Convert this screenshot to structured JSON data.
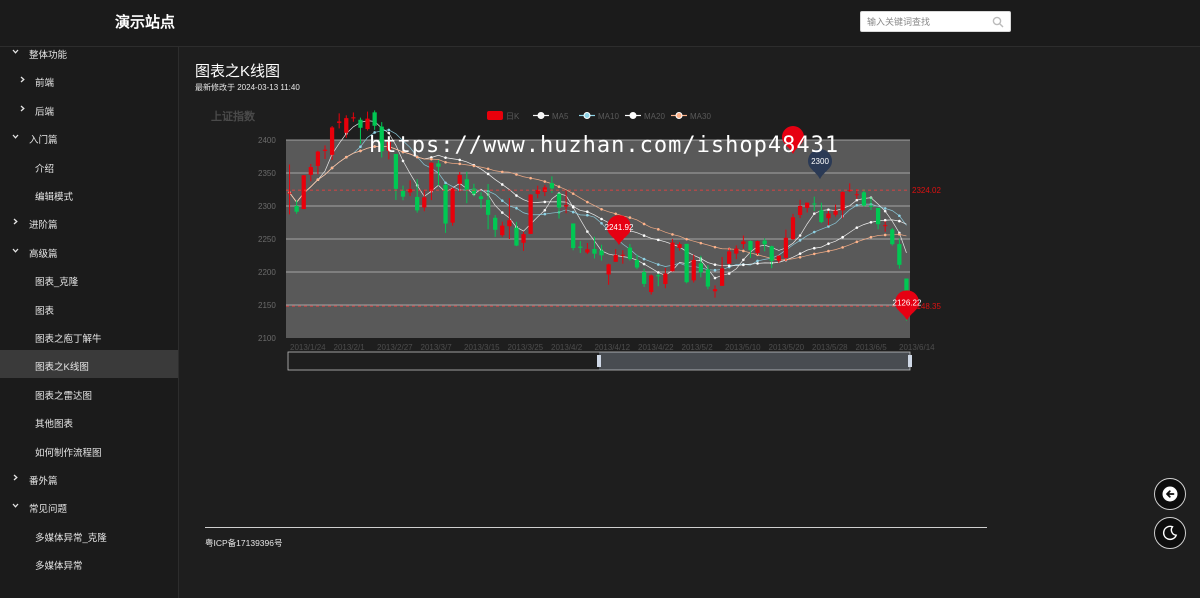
{
  "header": {
    "site_title": "演示站点",
    "search_placeholder": "输入关键词查找"
  },
  "sidebar": {
    "items": [
      {
        "label": "整体功能",
        "level": 0,
        "expanded": true
      },
      {
        "label": "前端",
        "level": 1,
        "expanded": false
      },
      {
        "label": "后端",
        "level": 1,
        "expanded": false
      },
      {
        "label": "入门篇",
        "level": 0,
        "expanded": true
      },
      {
        "label": "介绍",
        "level": 1
      },
      {
        "label": "编辑模式",
        "level": 1
      },
      {
        "label": "进阶篇",
        "level": 0,
        "expanded": false
      },
      {
        "label": "高级篇",
        "level": 0,
        "expanded": true
      },
      {
        "label": "图表_克隆",
        "level": 1
      },
      {
        "label": "图表",
        "level": 1
      },
      {
        "label": "图表之庖丁解牛",
        "level": 1
      },
      {
        "label": "图表之K线图",
        "level": 1,
        "active": true
      },
      {
        "label": "图表之雷达图",
        "level": 1
      },
      {
        "label": "其他图表",
        "level": 1
      },
      {
        "label": "如何制作流程图",
        "level": 1
      },
      {
        "label": "番外篇",
        "level": 0,
        "expanded": false
      },
      {
        "label": "常见问题",
        "level": 0,
        "expanded": true
      },
      {
        "label": "多媒体异常_克隆",
        "level": 1
      },
      {
        "label": "多媒体异常",
        "level": 1
      }
    ]
  },
  "content": {
    "page_title": "图表之K线图",
    "modified": "最新修改于 2024-03-13 11:40"
  },
  "watermark": "https://www.huzhan.com/ishop48431",
  "footer": {
    "icp": "粤ICP备17139396号"
  },
  "colors": {
    "up": "#e8000b",
    "down": "#00c853",
    "background": "#1e1e1e",
    "plot_bg": "#595959"
  },
  "icons": {
    "search": "search-icon",
    "back": "back-arrow-icon",
    "theme": "moon-icon"
  },
  "chart_data": {
    "type": "candlestick",
    "title": "上证指数",
    "legend": [
      "日K",
      "MA5",
      "MA10",
      "MA20",
      "MA30"
    ],
    "ylim": [
      2100,
      2400
    ],
    "y_ticks": [
      2100,
      2150,
      2200,
      2250,
      2300,
      2350,
      2400
    ],
    "x_ticks": [
      "2013/1/24",
      "2013/2/1",
      "2013/2/27",
      "2013/3/7",
      "2013/3/15",
      "2013/3/25",
      "2013/4/2",
      "2013/4/12",
      "2013/4/22",
      "2013/5/2",
      "2013/5/10",
      "2013/5/20",
      "2013/5/28",
      "2013/6/5",
      "2013/6/14"
    ],
    "candles": [
      {
        "o": 2320.26,
        "c": 2320.26,
        "l": 2287.3,
        "h": 2362.94
      },
      {
        "o": 2300,
        "c": 2291.3,
        "l": 2288.26,
        "h": 2308.38
      },
      {
        "o": 2295.35,
        "c": 2346.5,
        "l": 2295.35,
        "h": 2346.92
      },
      {
        "o": 2347.22,
        "c": 2358.98,
        "l": 2337.35,
        "h": 2363.8
      },
      {
        "o": 2360.75,
        "c": 2382.48,
        "l": 2347.89,
        "h": 2383.76
      },
      {
        "o": 2383.43,
        "c": 2385.42,
        "l": 2371.23,
        "h": 2391.82
      },
      {
        "o": 2377.41,
        "c": 2419.02,
        "l": 2369.57,
        "h": 2421.15
      },
      {
        "o": 2425.92,
        "c": 2428.15,
        "l": 2417.58,
        "h": 2440.38
      },
      {
        "o": 2411,
        "c": 2433.13,
        "l": 2403.3,
        "h": 2437.42
      },
      {
        "o": 2432.68,
        "c": 2434.48,
        "l": 2427.7,
        "h": 2441.73
      },
      {
        "o": 2430.69,
        "c": 2418.53,
        "l": 2394.22,
        "h": 2433.89
      },
      {
        "o": 2416.62,
        "c": 2432.4,
        "l": 2414.4,
        "h": 2443.03
      },
      {
        "o": 2441.91,
        "c": 2421.56,
        "l": 2415.43,
        "h": 2444.8
      },
      {
        "o": 2420.26,
        "c": 2382.91,
        "l": 2373.53,
        "h": 2427.07
      },
      {
        "o": 2383.49,
        "c": 2397.18,
        "l": 2370.61,
        "h": 2397.94
      },
      {
        "o": 2378.82,
        "c": 2325.95,
        "l": 2309.17,
        "h": 2378.82
      },
      {
        "o": 2322.94,
        "c": 2314.16,
        "l": 2308.76,
        "h": 2330.88
      },
      {
        "o": 2320.62,
        "c": 2325.82,
        "l": 2315.01,
        "h": 2338.78
      },
      {
        "o": 2313.74,
        "c": 2293.34,
        "l": 2289.89,
        "h": 2340.71
      },
      {
        "o": 2297.77,
        "c": 2313.22,
        "l": 2292.03,
        "h": 2324.63
      },
      {
        "o": 2322.32,
        "c": 2365.59,
        "l": 2308.92,
        "h": 2366.16
      },
      {
        "o": 2364.54,
        "c": 2359.51,
        "l": 2330.86,
        "h": 2369.65
      },
      {
        "o": 2332.08,
        "c": 2273.4,
        "l": 2259.25,
        "h": 2333.54
      },
      {
        "o": 2274.81,
        "c": 2326.31,
        "l": 2270.1,
        "h": 2328.14
      },
      {
        "o": 2333.61,
        "c": 2347.18,
        "l": 2321.6,
        "h": 2351.44
      },
      {
        "o": 2340.44,
        "c": 2324.29,
        "l": 2304.27,
        "h": 2352.02
      },
      {
        "o": 2326.42,
        "c": 2318.61,
        "l": 2314.59,
        "h": 2333.67
      },
      {
        "o": 2314.68,
        "c": 2310.59,
        "l": 2296.58,
        "h": 2320.96
      },
      {
        "o": 2309.16,
        "c": 2286.6,
        "l": 2264.83,
        "h": 2333.29
      },
      {
        "o": 2282.17,
        "c": 2263.97,
        "l": 2253.25,
        "h": 2286.33
      },
      {
        "o": 2255.77,
        "c": 2270.28,
        "l": 2253.31,
        "h": 2276.22
      },
      {
        "o": 2269.31,
        "c": 2278.4,
        "l": 2250,
        "h": 2312.08
      },
      {
        "o": 2267.29,
        "c": 2240.02,
        "l": 2239.21,
        "h": 2276.05
      },
      {
        "o": 2244.26,
        "c": 2257.43,
        "l": 2232.02,
        "h": 2261.31
      },
      {
        "o": 2257.74,
        "c": 2317.37,
        "l": 2257.42,
        "h": 2317.86
      },
      {
        "o": 2318.21,
        "c": 2324.24,
        "l": 2311.6,
        "h": 2330.81
      },
      {
        "o": 2321.4,
        "c": 2328.28,
        "l": 2314.97,
        "h": 2332
      },
      {
        "o": 2334.74,
        "c": 2326.72,
        "l": 2319.91,
        "h": 2344.89
      },
      {
        "o": 2318.58,
        "c": 2297.67,
        "l": 2281.12,
        "h": 2319.99
      },
      {
        "o": 2299.38,
        "c": 2301.26,
        "l": 2289,
        "h": 2323.48
      },
      {
        "o": 2273.55,
        "c": 2236.3,
        "l": 2232.91,
        "h": 2273.55
      },
      {
        "o": 2238.49,
        "c": 2236.62,
        "l": 2228.81,
        "h": 2246.87
      },
      {
        "o": 2229.46,
        "c": 2234.4,
        "l": 2227.31,
        "h": 2243.95
      },
      {
        "o": 2234.9,
        "c": 2227.74,
        "l": 2220.44,
        "h": 2253.42
      },
      {
        "o": 2232.69,
        "c": 2225.29,
        "l": 2217.25,
        "h": 2241.34
      },
      {
        "o": 2196.24,
        "c": 2211.59,
        "l": 2180.67,
        "h": 2212.59
      },
      {
        "o": 2215.47,
        "c": 2225.77,
        "l": 2215.47,
        "h": 2234.73
      },
      {
        "o": 2224.93,
        "c": 2226.13,
        "l": 2212.56,
        "h": 2233.04
      },
      {
        "o": 2236.98,
        "c": 2219.55,
        "l": 2217.26,
        "h": 2242.48
      },
      {
        "o": 2218.09,
        "c": 2206.78,
        "l": 2204.44,
        "h": 2226.26
      },
      {
        "o": 2199.91,
        "c": 2181.94,
        "l": 2177.39,
        "h": 2204.99
      },
      {
        "o": 2169.63,
        "c": 2194.85,
        "l": 2165.78,
        "h": 2196.43
      },
      {
        "o": 2195.03,
        "c": 2193.8,
        "l": 2178.47,
        "h": 2197.51
      },
      {
        "o": 2181.82,
        "c": 2197.6,
        "l": 2175.44,
        "h": 2206.03
      },
      {
        "o": 2201.12,
        "c": 2244.64,
        "l": 2200.58,
        "h": 2250.11
      },
      {
        "o": 2236.4,
        "c": 2242.17,
        "l": 2232.26,
        "h": 2245.12
      },
      {
        "o": 2242.62,
        "c": 2184.54,
        "l": 2182.81,
        "h": 2242.62
      },
      {
        "o": 2187.35,
        "c": 2218.32,
        "l": 2184.11,
        "h": 2226.12
      },
      {
        "o": 2213.19,
        "c": 2199.31,
        "l": 2191.85,
        "h": 2224.63
      },
      {
        "o": 2203.89,
        "c": 2177.91,
        "l": 2173.86,
        "h": 2210.58
      },
      {
        "o": 2170.78,
        "c": 2174.12,
        "l": 2161.14,
        "h": 2179.65
      },
      {
        "o": 2179.05,
        "c": 2205.5,
        "l": 2179.05,
        "h": 2222.81
      },
      {
        "o": 2212.5,
        "c": 2231.17,
        "l": 2212.5,
        "h": 2236.07
      },
      {
        "o": 2227.86,
        "c": 2235.57,
        "l": 2219.44,
        "h": 2240.26
      },
      {
        "o": 2242.39,
        "c": 2246.3,
        "l": 2235.42,
        "h": 2255.21
      },
      {
        "o": 2246.96,
        "c": 2232.97,
        "l": 2221.38,
        "h": 2247.86
      },
      {
        "o": 2228.82,
        "c": 2246.83,
        "l": 2225.81,
        "h": 2247.67
      },
      {
        "o": 2247.68,
        "c": 2241.92,
        "l": 2231.36,
        "h": 2250.85
      },
      {
        "o": 2238.9,
        "c": 2217.01,
        "l": 2205.87,
        "h": 2239.93
      },
      {
        "o": 2217.09,
        "c": 2224.8,
        "l": 2213.58,
        "h": 2225.19
      },
      {
        "o": 2221.34,
        "c": 2251.81,
        "l": 2216.7,
        "h": 2264.21
      },
      {
        "o": 2249.81,
        "c": 2282.87,
        "l": 2248.41,
        "h": 2288.09
      },
      {
        "o": 2286.33,
        "c": 2299.99,
        "l": 2281.9,
        "h": 2309.39
      },
      {
        "o": 2297.11,
        "c": 2305.11,
        "l": 2290.12,
        "h": 2305.3
      },
      {
        "o": 2303.75,
        "c": 2302.4,
        "l": 2292.43,
        "h": 2314.18
      },
      {
        "o": 2293.81,
        "c": 2275.67,
        "l": 2274.1,
        "h": 2304.95
      },
      {
        "o": 2281.45,
        "c": 2288.53,
        "l": 2270.53,
        "h": 2292.79
      },
      {
        "o": 2286.66,
        "c": 2293.08,
        "l": 2283.94,
        "h": 2302.11
      },
      {
        "o": 2293.4,
        "c": 2321.32,
        "l": 2281.47,
        "h": 2322.1
      },
      {
        "o": 2323.54,
        "c": 2324.02,
        "l": 2321.17,
        "h": 2334.33
      },
      {
        "o": 2316.25,
        "c": 2317.75,
        "l": 2310.49,
        "h": 2325.72
      },
      {
        "o": 2320.74,
        "c": 2300.59,
        "l": 2299.37,
        "h": 2325.53
      },
      {
        "o": 2300.21,
        "c": 2299.25,
        "l": 2294.11,
        "h": 2313.43
      },
      {
        "o": 2297.1,
        "c": 2272.42,
        "l": 2264.76,
        "h": 2297.1
      },
      {
        "o": 2270.71,
        "c": 2270.93,
        "l": 2260.87,
        "h": 2276.86
      },
      {
        "o": 2264.43,
        "c": 2242.11,
        "l": 2240.07,
        "h": 2266.69
      },
      {
        "o": 2242.26,
        "c": 2210.9,
        "l": 2205.07,
        "h": 2250.63
      },
      {
        "o": 2190.1,
        "c": 2148.35,
        "l": 2126.22,
        "h": 2190.1
      }
    ],
    "markers": [
      {
        "label": "2241.92",
        "kind": "max-local",
        "value": 2241.92
      },
      {
        "label": "2300",
        "kind": "annotation",
        "value": 2300
      },
      {
        "label": "2126.22",
        "kind": "min",
        "value": 2126.22
      }
    ],
    "mark_lines": [
      {
        "label": "2324.02",
        "value": 2324.02
      },
      {
        "label": "2148.35",
        "value": 2148.35
      }
    ]
  }
}
